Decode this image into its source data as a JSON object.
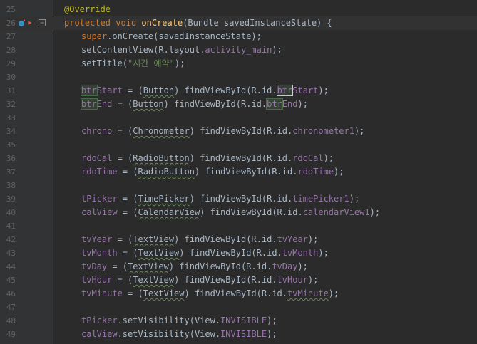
{
  "editor": {
    "colors": {
      "background": "#2b2b2b",
      "gutter": "#313335",
      "line_number": "#606366",
      "keyword": "#cc7832",
      "annotation": "#bbb529",
      "method": "#ffc66d",
      "string": "#6a8759",
      "field": "#9876aa",
      "plain": "#a9b7c6"
    },
    "lines": [
      {
        "num": "25",
        "indent": 0,
        "tokens": [
          {
            "t": "@Override",
            "c": "ann"
          }
        ]
      },
      {
        "num": "26",
        "indent": 0,
        "icons": [
          "override-method-icon",
          "breakpoint-icon",
          "fold-marker-icon"
        ],
        "highlight": true,
        "tokens": [
          {
            "t": "protected",
            "c": "kw"
          },
          {
            "t": " ",
            "c": "plain"
          },
          {
            "t": "void",
            "c": "kw"
          },
          {
            "t": " ",
            "c": "plain"
          },
          {
            "t": "onCreate",
            "c": "fn"
          },
          {
            "t": "(Bundle savedInstanceState) {",
            "c": "plain"
          }
        ]
      },
      {
        "num": "27",
        "indent": 1,
        "tokens": [
          {
            "t": "super",
            "c": "kw"
          },
          {
            "t": ".onCreate(savedInstanceState);",
            "c": "plain"
          }
        ]
      },
      {
        "num": "28",
        "indent": 1,
        "tokens": [
          {
            "t": "setContentView(R.layout.",
            "c": "plain"
          },
          {
            "t": "activity_main",
            "c": "fld"
          },
          {
            "t": ");",
            "c": "plain"
          }
        ]
      },
      {
        "num": "29",
        "indent": 1,
        "tokens": [
          {
            "t": "setTitle(",
            "c": "plain"
          },
          {
            "t": "\"시간 예약\"",
            "c": "str"
          },
          {
            "t": ");",
            "c": "plain"
          }
        ]
      },
      {
        "num": "30",
        "indent": 0,
        "tokens": []
      },
      {
        "num": "31",
        "indent": 1,
        "tokens": [
          {
            "t": "btr",
            "c": "fldh"
          },
          {
            "t": "Start",
            "c": "fld"
          },
          {
            "t": " = (",
            "c": "plain"
          },
          {
            "t": "Button",
            "c": "cls"
          },
          {
            "t": ") findViewById(R.id.",
            "c": "plain"
          },
          {
            "t": "btr",
            "c": "fldc"
          },
          {
            "t": "Start",
            "c": "fld"
          },
          {
            "t": ");",
            "c": "plain"
          }
        ]
      },
      {
        "num": "32",
        "indent": 1,
        "tokens": [
          {
            "t": "btr",
            "c": "fldh"
          },
          {
            "t": "End",
            "c": "fld"
          },
          {
            "t": " = (",
            "c": "plain"
          },
          {
            "t": "Button",
            "c": "cls"
          },
          {
            "t": ") findViewById(R.id.",
            "c": "plain"
          },
          {
            "t": "btr",
            "c": "fldh"
          },
          {
            "t": "End",
            "c": "fld"
          },
          {
            "t": ");",
            "c": "plain"
          }
        ]
      },
      {
        "num": "33",
        "indent": 0,
        "tokens": []
      },
      {
        "num": "34",
        "indent": 1,
        "tokens": [
          {
            "t": "chrono",
            "c": "fld"
          },
          {
            "t": " = (",
            "c": "plain"
          },
          {
            "t": "Chronometer",
            "c": "cls"
          },
          {
            "t": ") findViewById(R.id.",
            "c": "plain"
          },
          {
            "t": "chronometer1",
            "c": "fld"
          },
          {
            "t": ");",
            "c": "plain"
          }
        ]
      },
      {
        "num": "35",
        "indent": 0,
        "tokens": []
      },
      {
        "num": "36",
        "indent": 1,
        "tokens": [
          {
            "t": "rdoCal",
            "c": "fld"
          },
          {
            "t": " = (",
            "c": "plain"
          },
          {
            "t": "RadioButton",
            "c": "cls"
          },
          {
            "t": ") findViewById(R.id.",
            "c": "plain"
          },
          {
            "t": "rdoCal",
            "c": "fld"
          },
          {
            "t": ");",
            "c": "plain"
          }
        ]
      },
      {
        "num": "37",
        "indent": 1,
        "tokens": [
          {
            "t": "rdoTime",
            "c": "fld"
          },
          {
            "t": " = (",
            "c": "plain"
          },
          {
            "t": "RadioButton",
            "c": "cls"
          },
          {
            "t": ") findViewById(R.id.",
            "c": "plain"
          },
          {
            "t": "rdoTime",
            "c": "fld"
          },
          {
            "t": ");",
            "c": "plain"
          }
        ]
      },
      {
        "num": "38",
        "indent": 0,
        "tokens": []
      },
      {
        "num": "39",
        "indent": 1,
        "tokens": [
          {
            "t": "tPicker",
            "c": "fld"
          },
          {
            "t": " = (",
            "c": "plain"
          },
          {
            "t": "TimePicker",
            "c": "cls"
          },
          {
            "t": ") findViewById(R.id.",
            "c": "plain"
          },
          {
            "t": "timePicker1",
            "c": "fld"
          },
          {
            "t": ");",
            "c": "plain"
          }
        ]
      },
      {
        "num": "40",
        "indent": 1,
        "tokens": [
          {
            "t": "calView",
            "c": "fld"
          },
          {
            "t": " = (",
            "c": "plain"
          },
          {
            "t": "CalendarView",
            "c": "cls"
          },
          {
            "t": ") findViewById(R.id.",
            "c": "plain"
          },
          {
            "t": "calendarView1",
            "c": "fld"
          },
          {
            "t": ");",
            "c": "plain"
          }
        ]
      },
      {
        "num": "41",
        "indent": 0,
        "tokens": []
      },
      {
        "num": "42",
        "indent": 1,
        "tokens": [
          {
            "t": "tvYear",
            "c": "fld"
          },
          {
            "t": " = (",
            "c": "plain"
          },
          {
            "t": "TextView",
            "c": "cls"
          },
          {
            "t": ") findViewById(R.id.",
            "c": "plain"
          },
          {
            "t": "tvYear",
            "c": "fld"
          },
          {
            "t": ");",
            "c": "plain"
          }
        ]
      },
      {
        "num": "43",
        "indent": 1,
        "tokens": [
          {
            "t": "tvMonth",
            "c": "fld"
          },
          {
            "t": " = (",
            "c": "plain"
          },
          {
            "t": "TextView",
            "c": "cls"
          },
          {
            "t": ") findViewById(R.id.",
            "c": "plain"
          },
          {
            "t": "tvMonth",
            "c": "fld"
          },
          {
            "t": ");",
            "c": "plain"
          }
        ]
      },
      {
        "num": "44",
        "indent": 1,
        "tokens": [
          {
            "t": "tvDay",
            "c": "fld"
          },
          {
            "t": " = (",
            "c": "plain"
          },
          {
            "t": "TextView",
            "c": "cls"
          },
          {
            "t": ") findViewById(R.id.",
            "c": "plain"
          },
          {
            "t": "tvDay",
            "c": "fld"
          },
          {
            "t": ");",
            "c": "plain"
          }
        ]
      },
      {
        "num": "45",
        "indent": 1,
        "tokens": [
          {
            "t": "tvHour",
            "c": "fld"
          },
          {
            "t": " = (",
            "c": "plain"
          },
          {
            "t": "TextView",
            "c": "cls"
          },
          {
            "t": ") findViewById(R.id.",
            "c": "plain"
          },
          {
            "t": "tvHour",
            "c": "fld"
          },
          {
            "t": ");",
            "c": "plain"
          }
        ]
      },
      {
        "num": "46",
        "indent": 1,
        "tokens": [
          {
            "t": "tvMinute",
            "c": "fld"
          },
          {
            "t": " = (",
            "c": "plain"
          },
          {
            "t": "TextView",
            "c": "cls"
          },
          {
            "t": ") findViewById(R.id.",
            "c": "plain"
          },
          {
            "t": "tvMinute",
            "c": "fldu"
          },
          {
            "t": ");",
            "c": "plain"
          }
        ]
      },
      {
        "num": "47",
        "indent": 0,
        "tokens": []
      },
      {
        "num": "48",
        "indent": 1,
        "tokens": [
          {
            "t": "tPicker",
            "c": "fld"
          },
          {
            "t": ".setVisibility(View.",
            "c": "plain"
          },
          {
            "t": "INVISIBLE",
            "c": "fld"
          },
          {
            "t": ");",
            "c": "plain"
          }
        ]
      },
      {
        "num": "49",
        "indent": 1,
        "tokens": [
          {
            "t": "calView",
            "c": "fld"
          },
          {
            "t": ".setVisibility(View.",
            "c": "plain"
          },
          {
            "t": "INVISIBLE",
            "c": "fld"
          },
          {
            "t": ");",
            "c": "plain"
          }
        ]
      }
    ]
  }
}
